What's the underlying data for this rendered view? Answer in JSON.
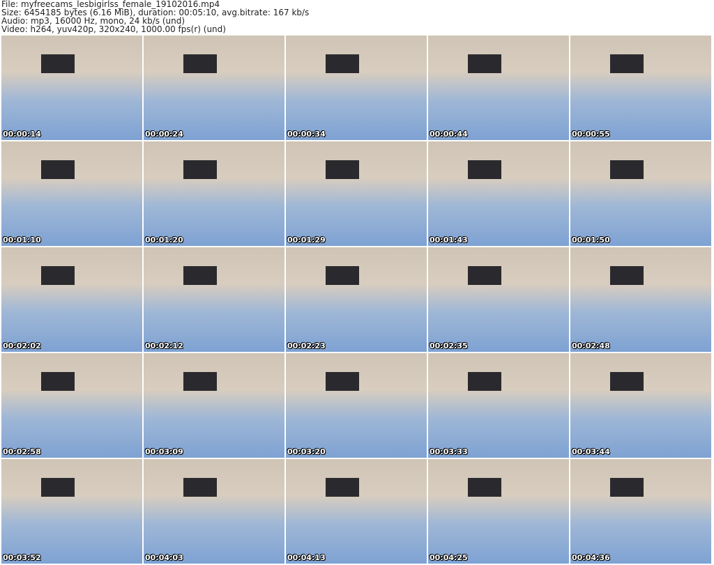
{
  "header": {
    "file": "File: myfreecams_lesbigirlss_female_19102016.mp4",
    "size": "Size: 6454185 bytes (6.16 MiB), duration: 00:05:10, avg.bitrate: 167 kb/s",
    "audio": "Audio: mp3, 16000 Hz, mono, 24 kb/s (und)",
    "video": "Video: h264, yuv420p, 320x240, 1000.00 fps(r) (und)"
  },
  "thumbnails": [
    "00:00:14",
    "00:00:24",
    "00:00:34",
    "00:00:44",
    "00:00:55",
    "00:01:10",
    "00:01:20",
    "00:01:29",
    "00:01:43",
    "00:01:50",
    "00:02:02",
    "00:02:12",
    "00:02:23",
    "00:02:35",
    "00:02:48",
    "00:02:58",
    "00:03:09",
    "00:03:20",
    "00:03:33",
    "00:03:44",
    "00:03:52",
    "00:04:03",
    "00:04:13",
    "00:04:25",
    "00:04:36"
  ]
}
